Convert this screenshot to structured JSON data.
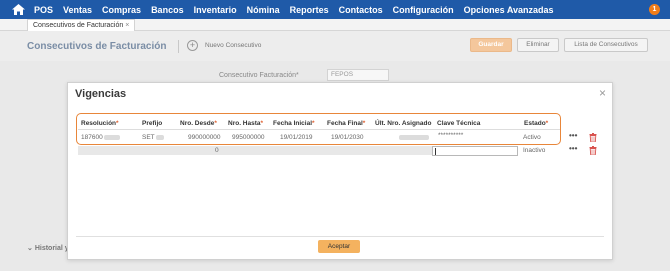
{
  "nav": {
    "items": [
      "POS",
      "Ventas",
      "Compras",
      "Bancos",
      "Inventario",
      "Nómina",
      "Reportes",
      "Contactos",
      "Configuración",
      "Opciones Avanzadas"
    ],
    "notification_count": "1"
  },
  "tab": {
    "label": "Consecutivos de Facturación",
    "close": "×"
  },
  "header": {
    "title": "Consecutivos de Facturación",
    "new_label": "Nuevo Consecutivo",
    "save_label": "Guardar",
    "delete_label": "Eliminar",
    "list_label": "Lista de Consecutivos"
  },
  "form": {
    "consecutivo_label": "Consecutivo Facturación",
    "consecutivo_required": "*",
    "consecutivo_value": "FEPOS"
  },
  "history_label": "Historial y",
  "modal": {
    "title": "Vigencias",
    "close": "×",
    "columns": [
      {
        "label": "Resolución",
        "req": "*"
      },
      {
        "label": "Prefijo",
        "req": ""
      },
      {
        "label": "Nro. Desde",
        "req": "*"
      },
      {
        "label": "Nro. Hasta",
        "req": "*"
      },
      {
        "label": "Fecha Inicial",
        "req": "*"
      },
      {
        "label": "Fecha Final",
        "req": "*"
      },
      {
        "label": "Últ. Nro. Asignado",
        "req": ""
      },
      {
        "label": "Clave Técnica",
        "req": ""
      },
      {
        "label": "Estado",
        "req": "*"
      }
    ],
    "rows": [
      {
        "resolucion": "187600",
        "prefijo": "SET",
        "desde": "990000000",
        "hasta": "995000000",
        "fecha_inicial": "19/01/2019",
        "fecha_final": "19/01/2030",
        "clave": "**********",
        "estado": "Activo",
        "more": "•••"
      },
      {
        "ult_nro": "0",
        "estado": "Inactivo",
        "more": "•••"
      }
    ],
    "accept_label": "Aceptar"
  },
  "colors": {
    "nav_bg": "#1f5aa8",
    "accent_orange": "#e8863a",
    "accept_bg": "#f4b25f",
    "trash_red": "#d9534f"
  }
}
